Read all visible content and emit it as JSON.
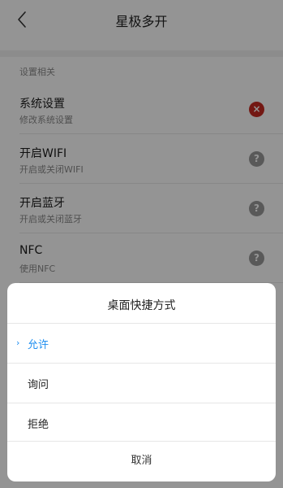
{
  "header": {
    "title": "星极多开",
    "back_icon": "chevron-left-icon"
  },
  "section": {
    "title": "设置相关"
  },
  "settings": [
    {
      "title": "系统设置",
      "subtitle": "修改系统设置",
      "status": "denied",
      "status_icon": "close-icon",
      "status_glyph": "×",
      "status_color": "#c62a22"
    },
    {
      "title": "开启WIFI",
      "subtitle": "开启或关闭WIFI",
      "status": "unknown",
      "status_icon": "question-icon",
      "status_glyph": "?",
      "status_color": "#9a9a9a"
    },
    {
      "title": "开启蓝牙",
      "subtitle": "开启或关闭蓝牙",
      "status": "unknown",
      "status_icon": "question-icon",
      "status_glyph": "?",
      "status_color": "#9a9a9a"
    },
    {
      "title": "NFC",
      "subtitle": "使用NFC",
      "status": "unknown",
      "status_icon": "question-icon",
      "status_glyph": "?",
      "status_color": "#9a9a9a"
    }
  ],
  "dialog": {
    "title": "桌面快捷方式",
    "options": [
      {
        "label": "允许",
        "selected": true
      },
      {
        "label": "询问",
        "selected": false
      },
      {
        "label": "拒绝",
        "selected": false
      }
    ],
    "check_glyph": "›",
    "cancel_label": "取消"
  },
  "colors": {
    "accent": "#1e8ef0",
    "deny": "#c62a22",
    "unknown": "#9a9a9a"
  }
}
